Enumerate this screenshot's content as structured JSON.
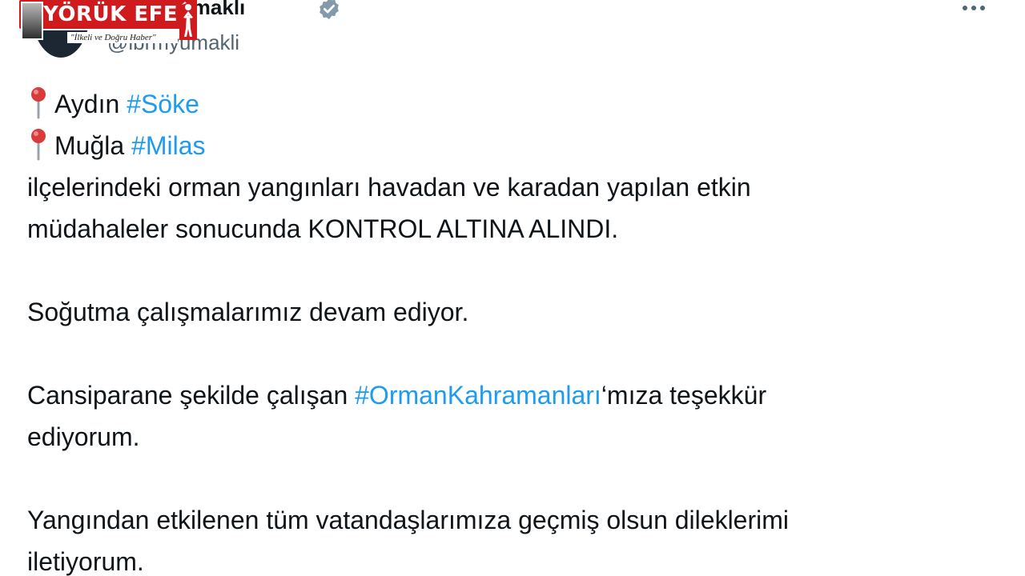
{
  "author": {
    "name_visible": "Yumaklı",
    "handle_visible": "@ibr",
    "handle_tail": "myumakli",
    "verified_icon": "verified-badge-icon"
  },
  "watermark": {
    "brand": "YÖRÜK EFE",
    "tagline": "\"İlkeli ve Doğru Haber\""
  },
  "more_icon": "more-options-icon",
  "tweet": {
    "location_1_label": "Aydın",
    "location_1_tag": "#Söke",
    "location_2_label": "Muğla",
    "location_2_tag": "#Milas",
    "line_3": "ilçelerindeki orman yangınları havadan ve karadan yapılan etkin",
    "line_4": "müdahaleler sonucunda KONTROL ALTINA ALINDI.",
    "line_5": "Soğutma çalışmalarımız devam ediyor.",
    "line_6_prefix": "Cansiparane şekilde çalışan",
    "line_6_tag": "#OrmanKahramanları",
    "line_6_suffix": "‘mıza teşekkür",
    "line_7": "ediyorum.",
    "line_8": "Yangından etkilenen tüm vatandaşlarımıza geçmiş olsun dileklerimi",
    "line_9": "iletiyorum."
  },
  "colors": {
    "hashtag": "#1d9bf0",
    "text": "#0f1419",
    "secondary": "#536471",
    "logo_red": "#cf1b1e",
    "pin_red": "#d93a3a"
  }
}
